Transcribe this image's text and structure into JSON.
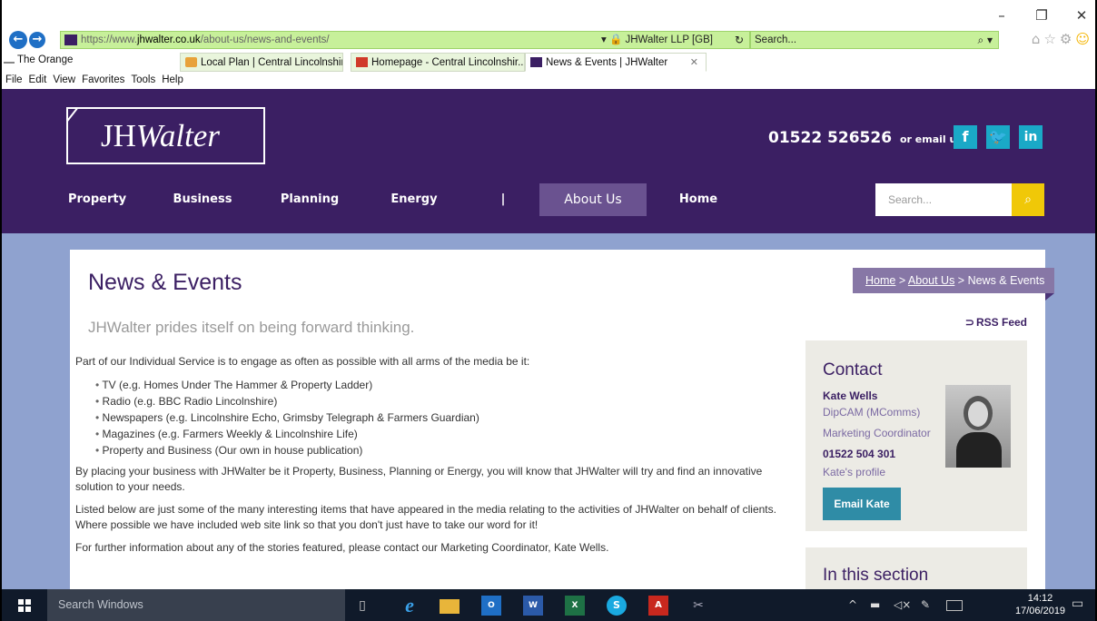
{
  "browser": {
    "url_prefix": "https://www.",
    "url_host": "jhwalter.co.uk",
    "url_path": "/about-us/news-and-events/",
    "site_identity": "JHWalter LLP [GB]",
    "search_placeholder": "Search...",
    "favorites_item": "The Orange",
    "tabs": [
      {
        "label": "Local Plan | Central Lincolnshire"
      },
      {
        "label": "Homepage - Central Lincolnshir..."
      },
      {
        "label": "News & Events | JHWalter"
      }
    ],
    "menu": [
      "File",
      "Edit",
      "View",
      "Favorites",
      "Tools",
      "Help"
    ]
  },
  "site": {
    "logo_plain": "JH",
    "logo_italic": "Walter",
    "phone": "01522 526526",
    "email_text": "or email us",
    "social": [
      "f",
      "t",
      "in"
    ],
    "nav": [
      "Property",
      "Business",
      "Planning",
      "Energy",
      "|",
      "About Us",
      "Home"
    ],
    "search_placeholder": "Search...",
    "colors": {
      "header": "#3b1f63",
      "accent": "#f0c808",
      "social": "#1aa9c7"
    }
  },
  "page": {
    "title": "News & Events",
    "breadcrumb": {
      "home": "Home",
      "sep1": " > ",
      "about": "About Us",
      "sep2": " > ",
      "current": "News & Events"
    },
    "intro": "JHWalter prides itself on being forward thinking.",
    "rss": "RSS Feed",
    "para1": "Part of our Individual Service is to engage as often as possible with all arms of the media be it:",
    "list": [
      "TV (e.g. Homes Under The Hammer & Property Ladder)",
      "Radio (e.g. BBC Radio Lincolnshire)",
      "Newspapers (e.g. Lincolnshire Echo, Grimsby Telegraph & Farmers Guardian)",
      "Magazines (e.g. Farmers Weekly & Lincolnshire Life)",
      "Property and Business (Our own in house publication)"
    ],
    "para2": "By placing your business with JHWalter be it Property, Business, Planning or Energy, you will know that JHWalter will try and find an innovative solution to your needs.",
    "para3": "Listed below are just some of the many interesting items that have appeared in the media relating to the activities of JHWalter on behalf of clients. Where possible we have included web site link so that you don't just have to take our word for it!",
    "para4": "For further information about any of the stories featured, please contact our Marketing Coordinator, Kate Wells."
  },
  "contact": {
    "title": "Contact",
    "name": "Kate Wells",
    "qualification": "DipCAM (MComms)",
    "role": "Marketing Coordinator",
    "phone": "01522 504 301",
    "profile_link": "Kate's profile",
    "email_button": "Email Kate"
  },
  "section_nav": {
    "title": "In this section"
  },
  "taskbar": {
    "search": "Search Windows",
    "time": "14:12",
    "date": "17/06/2019"
  }
}
